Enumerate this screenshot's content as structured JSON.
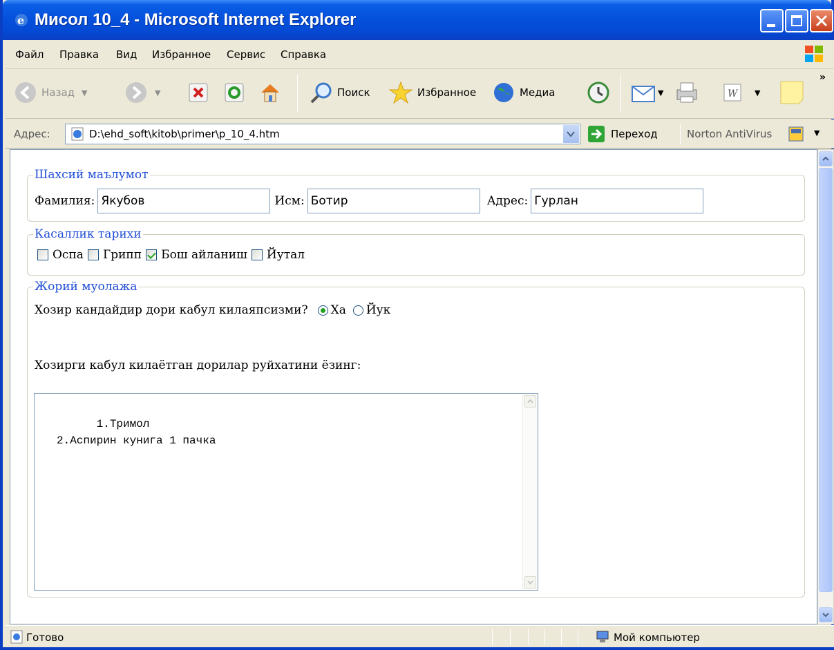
{
  "window": {
    "title": "Мисол 10_4 - Microsoft Internet Explorer"
  },
  "menu": [
    "Файл",
    "Правка",
    "Вид",
    "Избранное",
    "Сервис",
    "Справка"
  ],
  "toolbar": {
    "back": "Назад",
    "search": "Поиск",
    "favorites": "Избранное",
    "media": "Медиа"
  },
  "address": {
    "label": "Адрес:",
    "url": "D:\\ehd_soft\\kitob\\primer\\p_10_4.htm",
    "go": "Переход",
    "norton": "Norton AntiVirus"
  },
  "personal": {
    "legend": "Шахсий маълумот",
    "surname_label": "Фамилия:",
    "surname_value": "Якубов",
    "name_label": "Исм:",
    "name_value": "Ботир",
    "address_label": "Адрес:",
    "address_value": "Гурлан"
  },
  "history": {
    "legend": "Касаллик тарихи",
    "items": [
      {
        "label": "Оспа",
        "checked": false
      },
      {
        "label": "Грипп",
        "checked": false
      },
      {
        "label": "Бош айланиш",
        "checked": true
      },
      {
        "label": "Йутал",
        "checked": false
      }
    ]
  },
  "treatment": {
    "legend": "Жорий муолажа",
    "question": "Хозир кандайдир дори кабул килаяпсизми?",
    "yes": "Ха",
    "no": "Йук",
    "list_prompt": "Хозирги кабул килаётган дорилар руйхатини ёзинг:",
    "textarea": "1.Тримол\n2.Аспирин кунига 1 пачка"
  },
  "status": {
    "text": "Готово",
    "zone": "Мой компьютер"
  }
}
